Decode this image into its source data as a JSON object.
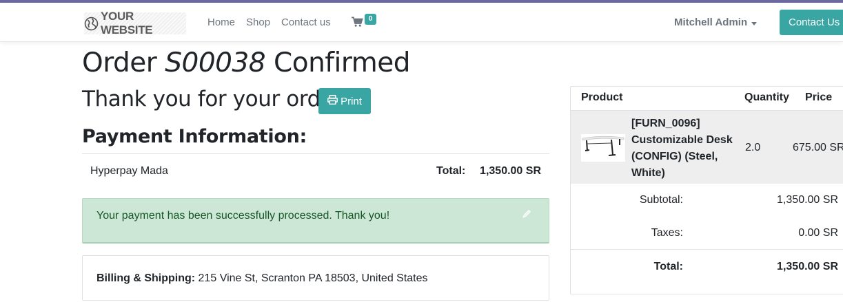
{
  "header": {
    "logo_text": "YOUR WEBSITE",
    "nav": [
      "Home",
      "Shop",
      "Contact us"
    ],
    "cart_count": "0",
    "user": "Mitchell Admin",
    "contact_button": "Contact Us"
  },
  "order": {
    "title_prefix": "Order",
    "number": "S00038",
    "title_suffix": "Confirmed",
    "thanks": "Thank you for your order.",
    "print_label": "Print"
  },
  "payment": {
    "heading": "Payment Information:",
    "method": "Hyperpay Mada",
    "total_label": "Total:",
    "total_value": "1,350.00 SR",
    "alert": "Your payment has been successfully processed. Thank you!"
  },
  "billing": {
    "label": "Billing & Shipping:",
    "address": "215 Vine St, Scranton PA 18503, United States"
  },
  "cart": {
    "headers": [
      "Product",
      "Quantity",
      "Price"
    ],
    "item": {
      "name": "[FURN_0096] Customizable Desk (CONFIG) (Steel, White)",
      "quantity": "2.0",
      "price": "675.00 SR"
    },
    "subtotal_label": "Subtotal:",
    "subtotal_value": "1,350.00 SR",
    "taxes_label": "Taxes:",
    "taxes_value": "0.00 SR",
    "total_label": "Total:",
    "total_value": "1,350.00 SR"
  },
  "colors": {
    "accent": "#3aa6a4",
    "top_border": "#6d68a0",
    "success_bg": "#cde7d6",
    "success_text": "#155724"
  }
}
